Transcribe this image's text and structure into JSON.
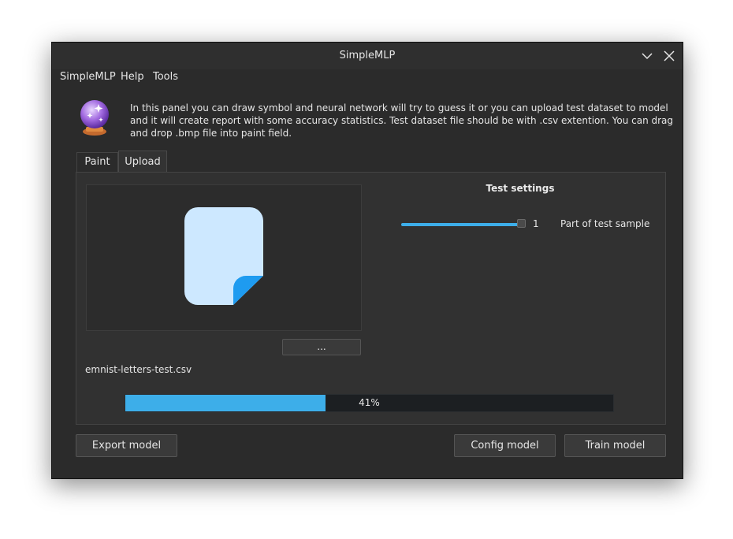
{
  "window": {
    "title": "SimpleMLP"
  },
  "menu": {
    "items": [
      "SimpleMLP",
      "Help",
      "Tools"
    ]
  },
  "info": {
    "text": "In this panel you can draw symbol and neural network will try to guess it or you can upload test dataset to model and it will create report with some accuracy statistics. Test dataset file should be with .csv extention. You can drag and drop .bmp file into paint field."
  },
  "tabs": {
    "paint": "Paint",
    "upload": "Upload",
    "active": "Upload"
  },
  "upload": {
    "browse_label": "...",
    "filename": "emnist-letters-test.csv",
    "progress_value": 41,
    "progress_text": "41%"
  },
  "settings": {
    "title": "Test settings",
    "slider_value": "1",
    "slider_fraction": 1,
    "slider_label": "Part of test sample"
  },
  "buttons": {
    "export": "Export model",
    "config": "Config model",
    "train": "Train model"
  },
  "colors": {
    "accent": "#3daee9",
    "window_bg": "#2b2b2b",
    "file_icon": "#cde8ff",
    "file_corner": "#1e9bf0"
  }
}
